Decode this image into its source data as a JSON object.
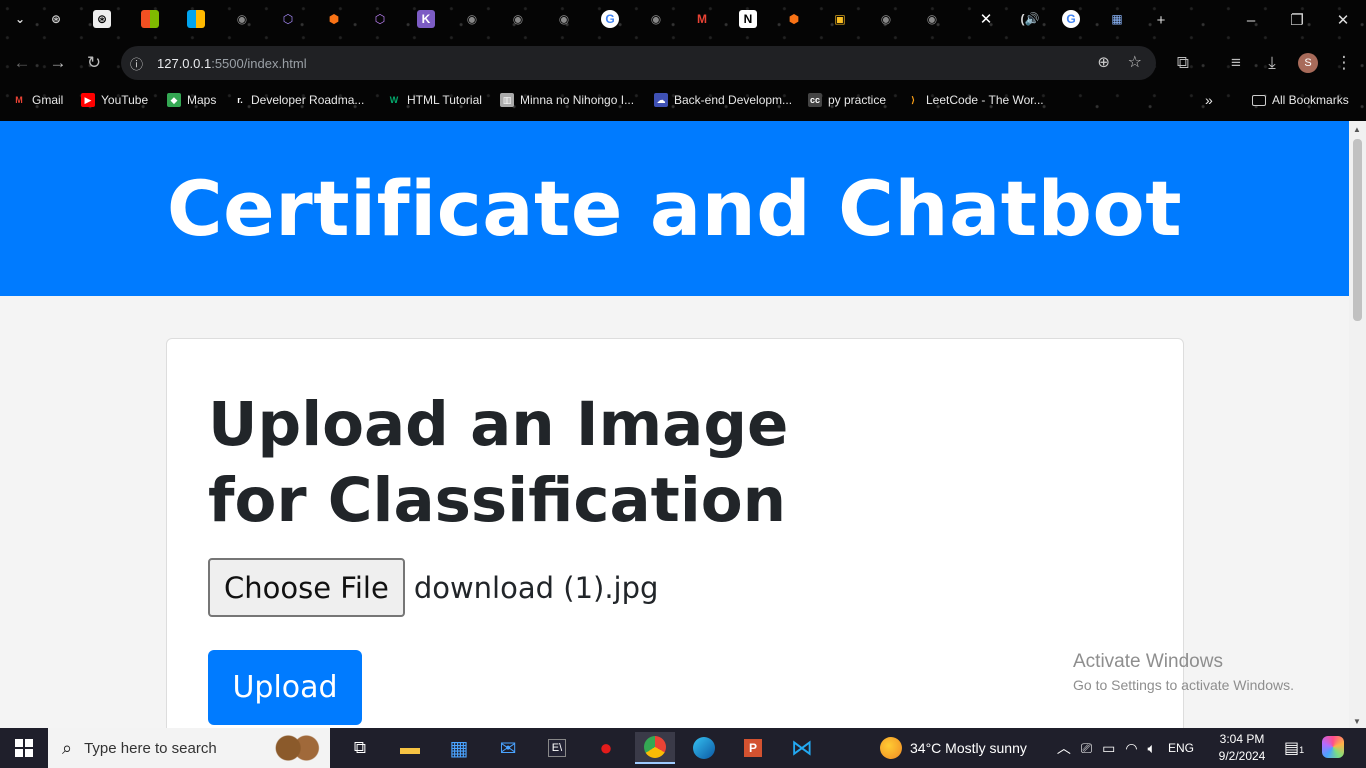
{
  "browser": {
    "tabs_count_label": "",
    "url_host": "127.0.0.1",
    "url_path": ":5500/index.html",
    "bookmarks": [
      {
        "label": "Gmail",
        "icon": "gmail-icon",
        "color": "#ea4335"
      },
      {
        "label": "YouTube",
        "icon": "youtube-icon",
        "color": "#ff0000"
      },
      {
        "label": "Maps",
        "icon": "maps-icon",
        "color": "#34a853"
      },
      {
        "label": "Developer Roadma...",
        "icon": "roadmap-icon",
        "color": "#ffffff"
      },
      {
        "label": "HTML Tutorial",
        "icon": "w3schools-icon",
        "color": "#04aa6d"
      },
      {
        "label": "Minna no Nihongo I...",
        "icon": "book-icon",
        "color": "#aaaaaa"
      },
      {
        "label": "Back-end Developm...",
        "icon": "cloud-icon",
        "color": "#3f51b5"
      },
      {
        "label": "py practice",
        "icon": "cc-icon",
        "color": "#333333"
      },
      {
        "label": "LeetCode - The Wor...",
        "icon": "leetcode-icon",
        "color": "#ffa116"
      }
    ],
    "all_bookmarks_label": "All Bookmarks",
    "profile_initial": "S"
  },
  "page": {
    "header_title": "Certificate and Chatbot",
    "card_heading": "Upload an Image for Classification",
    "choose_file_label": "Choose File",
    "file_name": "download (1).jpg",
    "upload_label": "Upload"
  },
  "watermark": {
    "title": "Activate Windows",
    "subtitle": "Go to Settings to activate Windows."
  },
  "taskbar": {
    "search_placeholder": "Type here to search",
    "weather": "34°C  Mostly sunny",
    "language": "ENG",
    "time": "3:04 PM",
    "date": "9/2/2024",
    "notification_count": "1"
  },
  "colors": {
    "header_blue": "#007bff",
    "page_bg": "#f4f4f4"
  }
}
